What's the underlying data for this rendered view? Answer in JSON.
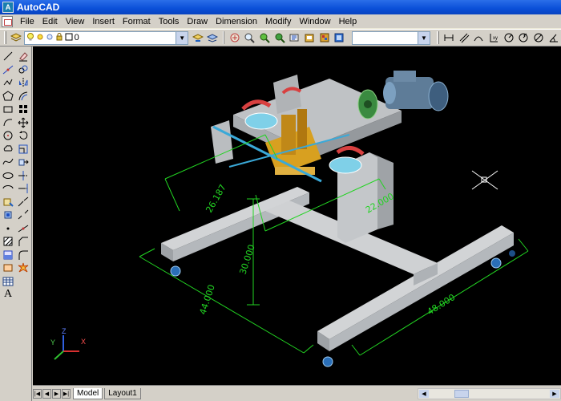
{
  "window": {
    "title": "AutoCAD"
  },
  "menu": [
    "File",
    "Edit",
    "View",
    "Insert",
    "Format",
    "Tools",
    "Draw",
    "Dimension",
    "Modify",
    "Window",
    "Help"
  ],
  "toolbar": {
    "layer_value": "0",
    "layer_icons": [
      "layers-icon",
      "lightbulb-icon",
      "sun-icon",
      "lock-icon",
      "color-swatch-icon"
    ],
    "zoom_icons": [
      "pan-icon",
      "zoom-realtime-icon",
      "zoom-window-icon",
      "zoom-previous-icon",
      "properties-icon",
      "design-center-icon",
      "tool-palettes-icon",
      "sheet-set-icon"
    ],
    "dim_icons": [
      "linear-dim-icon",
      "aligned-dim-icon",
      "arc-length-icon",
      "ordinate-icon",
      "radius-icon",
      "jogged-icon",
      "diameter-icon",
      "angular-icon"
    ]
  },
  "draw_tools": [
    "line-icon",
    "construction-line-icon",
    "polyline-icon",
    "polygon-icon",
    "rectangle-icon",
    "arc-icon",
    "circle-icon",
    "revision-cloud-icon",
    "spline-icon",
    "ellipse-icon",
    "ellipse-arc-icon",
    "insert-block-icon",
    "make-block-icon",
    "point-icon",
    "hatch-icon",
    "gradient-icon",
    "region-icon",
    "table-icon",
    "multiline-text-icon"
  ],
  "draw_tools_text_glyph": "A",
  "modify_tools": [
    "erase-icon",
    "copy-icon",
    "mirror-icon",
    "offset-icon",
    "array-icon",
    "move-icon",
    "rotate-icon",
    "scale-icon",
    "stretch-icon",
    "trim-icon",
    "extend-icon",
    "break-at-point-icon",
    "break-icon",
    "join-icon",
    "chamfer-icon",
    "fillet-icon",
    "explode-icon"
  ],
  "dimensions": [
    "26.187",
    "22.000",
    "30.000",
    "44.000",
    "48.000"
  ],
  "ucs": {
    "x": "X",
    "y": "Y",
    "z": "Z"
  },
  "tabs": [
    "Model",
    "Layout1"
  ],
  "colors": {
    "background": "#000000",
    "dimension": "#22d322",
    "steel": "#b8bcc0",
    "accent_blue": "#3aa9d8",
    "accent_yellow": "#d8a020",
    "accent_red": "#d84040"
  }
}
